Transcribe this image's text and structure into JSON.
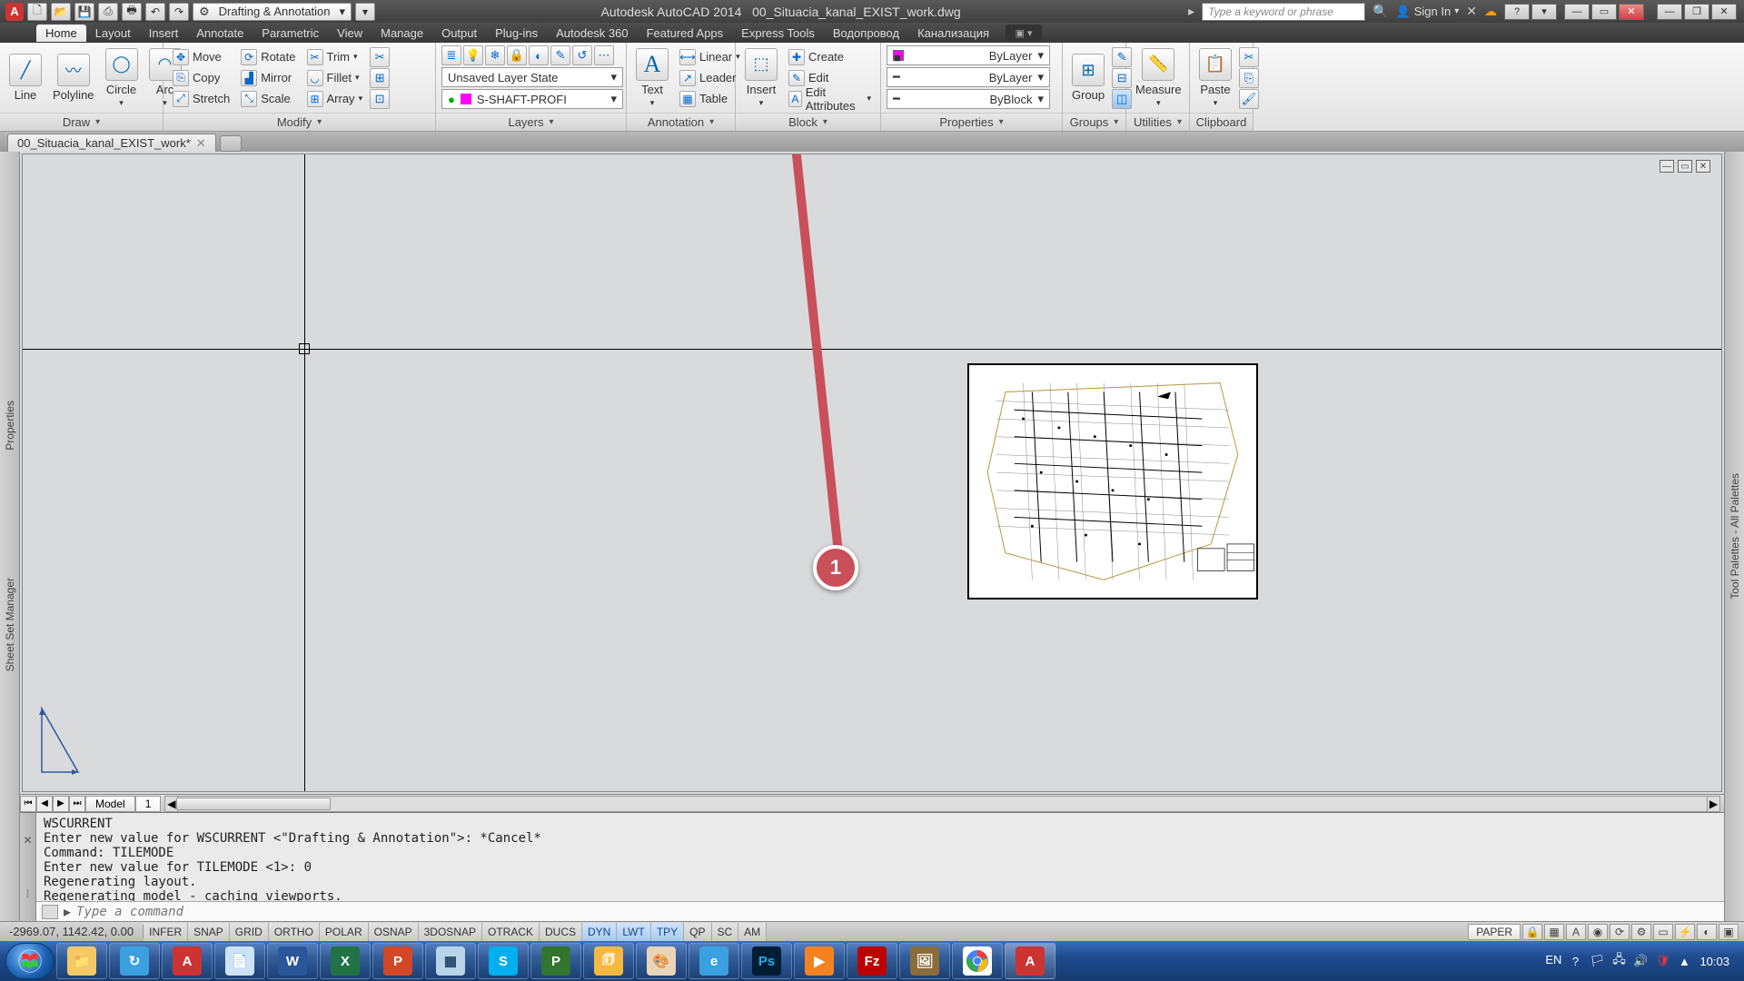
{
  "title": {
    "app": "Autodesk AutoCAD 2014",
    "file": "00_Situacia_kanal_EXIST_work.dwg"
  },
  "qat": {
    "workspace": "Drafting & Annotation"
  },
  "search_placeholder": "Type a keyword or phrase",
  "signin": "Sign In",
  "menus": [
    "Home",
    "Layout",
    "Insert",
    "Annotate",
    "Parametric",
    "View",
    "Manage",
    "Output",
    "Plug-ins",
    "Autodesk 360",
    "Featured Apps",
    "Express Tools",
    "Водопровод",
    "Канализация"
  ],
  "active_menu": "Home",
  "ribbon": {
    "draw": {
      "title": "Draw",
      "big": [
        "Line",
        "Polyline",
        "Circle",
        "Arc"
      ]
    },
    "modify": {
      "title": "Modify",
      "rows": [
        [
          "Move",
          "Rotate",
          "Trim"
        ],
        [
          "Copy",
          "Mirror",
          "Fillet"
        ],
        [
          "Stretch",
          "Scale",
          "Array"
        ]
      ]
    },
    "layers": {
      "title": "Layers",
      "state": "Unsaved Layer State",
      "current": "S-SHAFT-PROFI"
    },
    "annotation": {
      "title": "Annotation",
      "text": "Text",
      "rows": [
        "Linear",
        "Leader",
        "Table"
      ]
    },
    "block": {
      "title": "Block",
      "insert": "Insert",
      "rows": [
        "Create",
        "Edit",
        "Edit Attributes"
      ]
    },
    "properties": {
      "title": "Properties",
      "color": "ByLayer",
      "ltype": "ByLayer",
      "lweight": "ByBlock"
    },
    "groups": {
      "title": "Groups",
      "label": "Group"
    },
    "utilities": {
      "title": "Utilities",
      "label": "Measure"
    },
    "clipboard": {
      "title": "Clipboard",
      "label": "Paste"
    }
  },
  "filetab": "00_Situacia_kanal_EXIST_work*",
  "layout_tabs": [
    "Model",
    "1"
  ],
  "cmd_history": "WSCURRENT\nEnter new value for WSCURRENT <\"Drafting & Annotation\">: *Cancel*\nCommand: TILEMODE\nEnter new value for TILEMODE <1>: 0\nRegenerating layout.\nRegenerating model - caching viewports.",
  "cmd_prompt": "Type a command",
  "status": {
    "coords": "-2969.07, 1142.42, 0.00",
    "toggles": [
      "INFER",
      "SNAP",
      "GRID",
      "ORTHO",
      "POLAR",
      "OSNAP",
      "3DOSNAP",
      "OTRACK",
      "DUCS",
      "DYN",
      "LWT",
      "TPY",
      "QP",
      "SC",
      "AM"
    ],
    "on": [
      "DYN",
      "LWT",
      "TPY"
    ],
    "space": "PAPER"
  },
  "annotation_badge": "1",
  "side_left": [
    "Properties",
    "Sheet Set Manager"
  ],
  "side_right": "Tool Palettes - All Palettes",
  "tray": {
    "lang": "EN",
    "time": "10:03"
  }
}
